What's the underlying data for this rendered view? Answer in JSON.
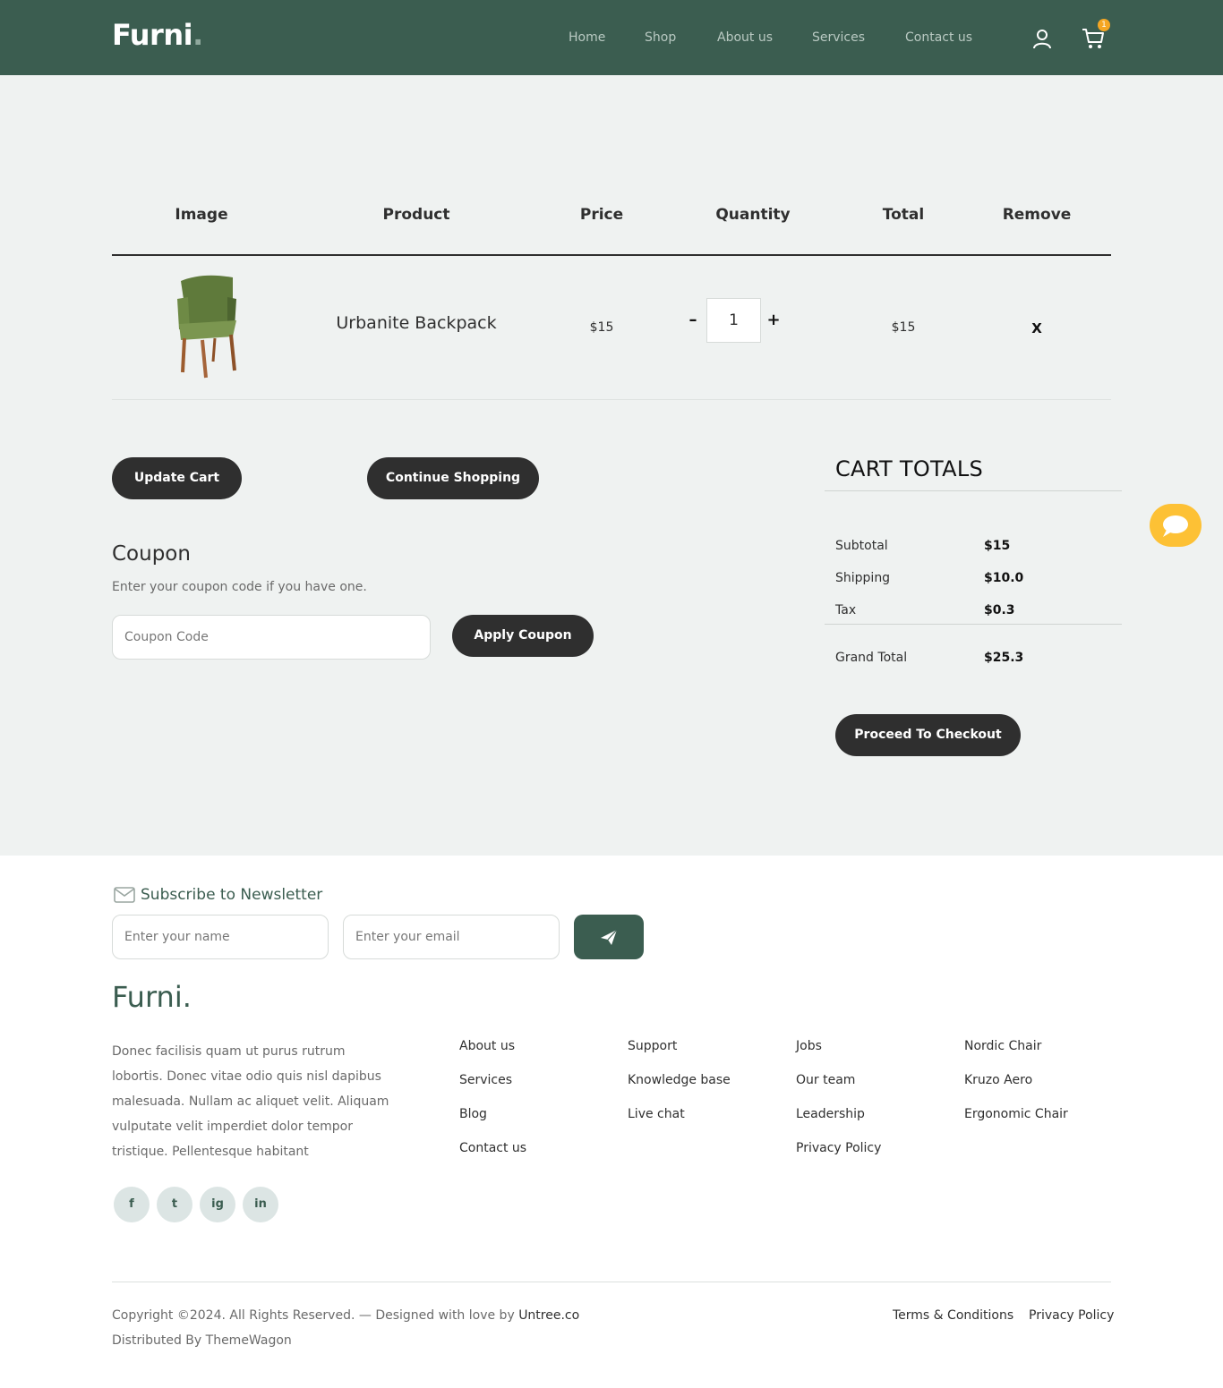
{
  "brand": {
    "name": "Furni",
    "dot": "."
  },
  "nav": {
    "links": [
      "Home",
      "Shop",
      "About us",
      "Services",
      "Contact us"
    ],
    "cart_count": "1",
    "icons": [
      "user-icon",
      "cart-icon"
    ]
  },
  "cart_table": {
    "headers": [
      "Image",
      "Product",
      "Price",
      "Quantity",
      "Total",
      "Remove"
    ],
    "rows": [
      {
        "product": "Urbanite Backpack",
        "price": "$15",
        "quantity": "1",
        "total": "$15",
        "remove": "X",
        "minus": "–",
        "plus": "+"
      }
    ]
  },
  "actions": {
    "update_cart": "Update Cart",
    "continue_shopping": "Continue Shopping"
  },
  "coupon": {
    "title": "Coupon",
    "subtitle": "Enter your coupon code if you have one.",
    "placeholder": "Coupon Code",
    "apply": "Apply Coupon"
  },
  "totals": {
    "title": "CART TOTALS",
    "subtotal_label": "Subtotal",
    "subtotal": "$15",
    "shipping_label": "Shipping",
    "shipping": "$10.0",
    "tax_label": "Tax",
    "tax": "$0.3",
    "grand_label": "Grand Total",
    "grand": "$25.3",
    "checkout": "Proceed To Checkout"
  },
  "newsletter": {
    "title": "Subscribe to Newsletter",
    "name_placeholder": "Enter your name",
    "email_placeholder": "Enter your email"
  },
  "footer": {
    "brand": "Furni.",
    "description": "Donec facilisis quam ut purus rutrum lobortis. Donec vitae odio quis nisl dapibus malesuada. Nullam ac aliquet velit. Aliquam vulputate velit imperdiet dolor tempor tristique. Pellentesque habitant",
    "social": [
      "f",
      "t",
      "ig",
      "in"
    ],
    "col1": [
      "About us",
      "Services",
      "Blog",
      "Contact us"
    ],
    "col2": [
      "Support",
      "Knowledge base",
      "Live chat"
    ],
    "col3": [
      "Jobs",
      "Our team",
      "Leadership",
      "Privacy Policy"
    ],
    "col4": [
      "Nordic Chair",
      "Kruzo Aero",
      "Ergonomic Chair"
    ],
    "copyright": "Copyright ©2024. All Rights Reserved. — Designed with love by",
    "copyright_link": "Untree.co",
    "distributed": "Distributed By ThemeWagon",
    "terms": "Terms & Conditions",
    "privacy": "Privacy Policy"
  },
  "colors": {
    "brand_green": "#3b5d50",
    "accent_yellow": "#fdc135",
    "badge_orange": "#f5a623",
    "button_dark": "#2f2f2f",
    "page_bg": "#eff2f1"
  }
}
